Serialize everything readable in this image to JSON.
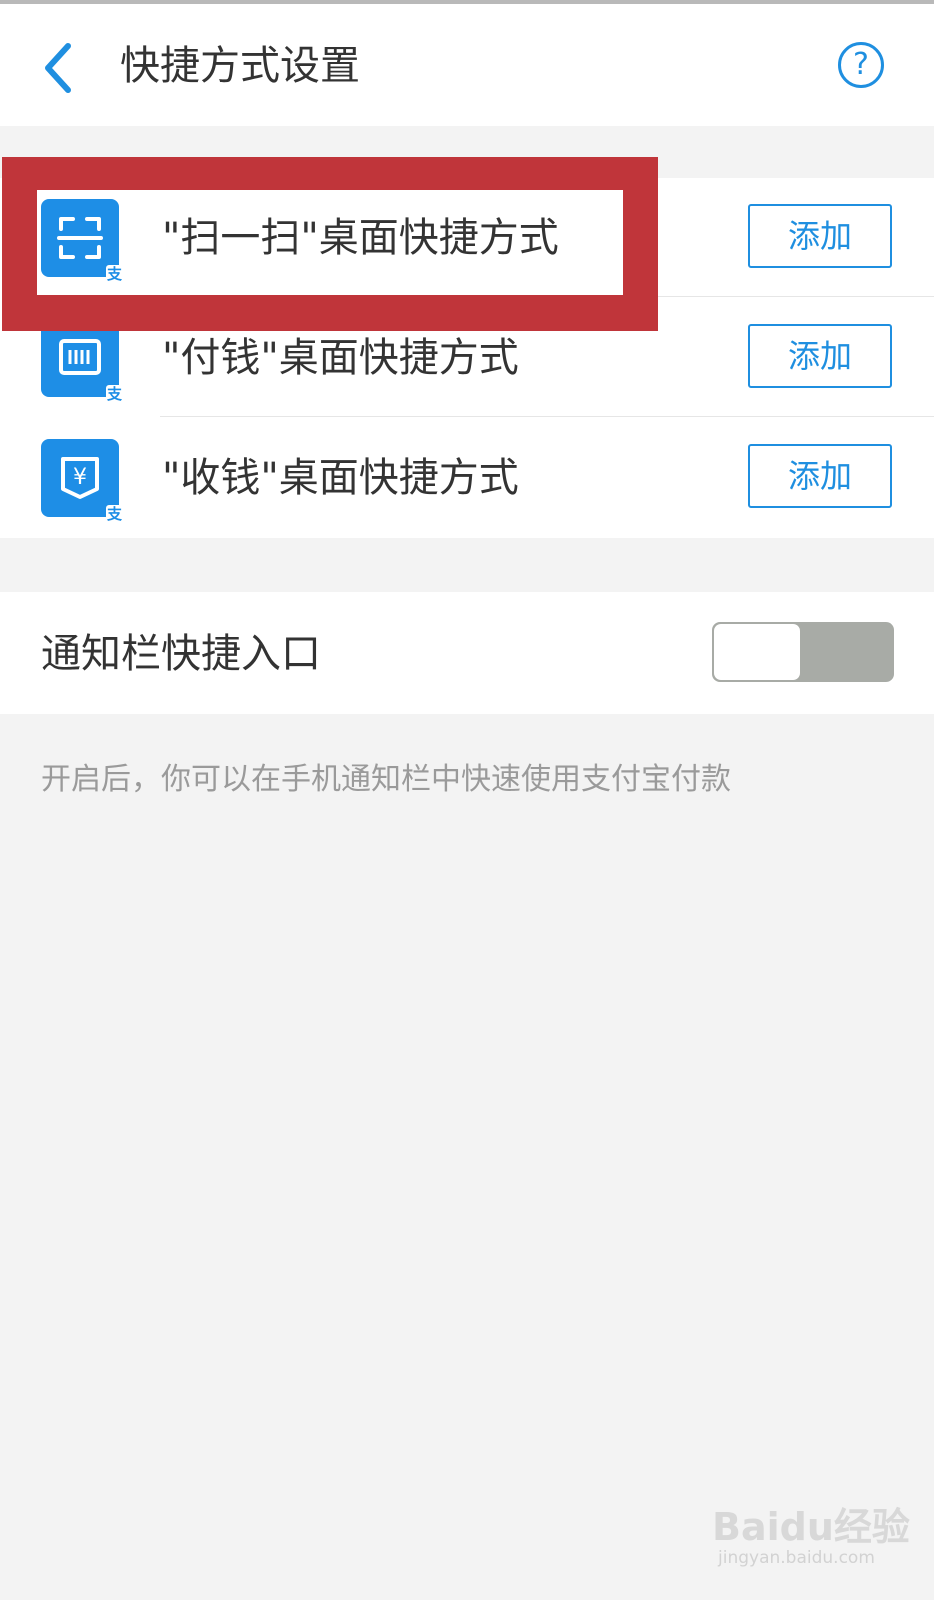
{
  "header": {
    "title": "快捷方式设置",
    "help_label": "?"
  },
  "shortcuts": {
    "items": [
      {
        "label": "\"扫一扫\"桌面快捷方式",
        "button": "添加",
        "icon": "scan-icon",
        "badge": "支"
      },
      {
        "label": "\"付钱\"桌面快捷方式",
        "button": "添加",
        "icon": "barcode-pay-icon",
        "badge": "支"
      },
      {
        "label": "\"收钱\"桌面快捷方式",
        "button": "添加",
        "icon": "yuan-receive-icon",
        "badge": "支"
      }
    ]
  },
  "notification": {
    "label": "通知栏快捷入口",
    "toggle_on": false,
    "hint": "开启后，你可以在手机通知栏中快速使用支付宝付款"
  },
  "watermark": {
    "brand": "Baidu经验",
    "url": "jingyan.baidu.com"
  },
  "colors": {
    "accent": "#1f8fe0",
    "highlight": "#c0353a",
    "toggle_off": "#a8aba6"
  }
}
